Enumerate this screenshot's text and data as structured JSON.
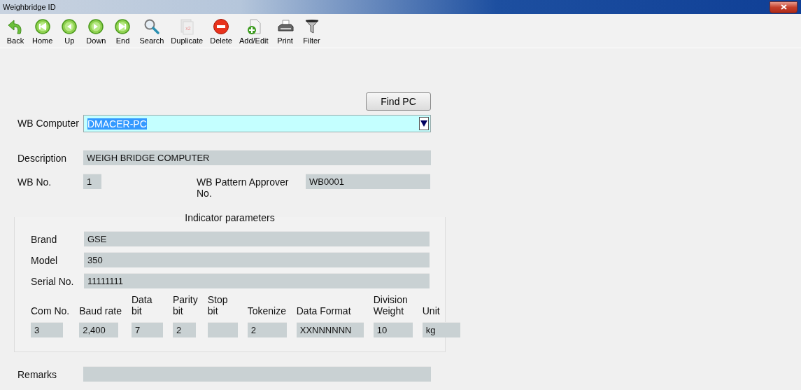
{
  "window": {
    "title": "Weighbridge ID"
  },
  "toolbar": [
    {
      "label": "Back",
      "kind": "back",
      "disabled": false
    },
    {
      "label": "Home",
      "kind": "home",
      "disabled": false
    },
    {
      "label": "Up",
      "kind": "up",
      "disabled": false
    },
    {
      "label": "Down",
      "kind": "down",
      "disabled": false
    },
    {
      "label": "End",
      "kind": "end",
      "disabled": false
    },
    {
      "label": "Search",
      "kind": "search",
      "disabled": false
    },
    {
      "label": "Duplicate",
      "kind": "duplicate",
      "disabled": true,
      "badge": "x2"
    },
    {
      "label": "Delete",
      "kind": "delete",
      "disabled": false
    },
    {
      "label": "Add/Edit",
      "kind": "add",
      "disabled": false
    },
    {
      "label": "Print",
      "kind": "print",
      "disabled": false
    },
    {
      "label": "Filter",
      "kind": "filter",
      "disabled": false
    }
  ],
  "find_button": "Find PC",
  "wb_computer": {
    "label": "WB Computer",
    "value": "DMACER-PC",
    "selected": true
  },
  "description": {
    "label": "Description",
    "value": "WEIGH BRIDGE COMPUTER"
  },
  "wb_no": {
    "label": "WB No.",
    "value": "1"
  },
  "pattern_approver": {
    "label": "WB Pattern Approver No.",
    "value": "WB0001"
  },
  "indicator": {
    "title": "Indicator parameters",
    "rows": [
      {
        "label": "Brand",
        "value": "GSE"
      },
      {
        "label": "Model",
        "value": "350"
      },
      {
        "label": "Serial No.",
        "value": "11111111"
      }
    ],
    "params": [
      {
        "label": "Com No.",
        "value": "3"
      },
      {
        "label": "Baud rate",
        "value": "2,400"
      },
      {
        "label": "Data\nbit",
        "value": "7"
      },
      {
        "label": "Parity\nbit",
        "value": "2"
      },
      {
        "label": "Stop\nbit"
      },
      {
        "label": "Tokenize",
        "value": "2"
      },
      {
        "label": "Data Format",
        "value": "XXNNNNNN"
      },
      {
        "label": "Division\nWeight",
        "value": "10"
      },
      {
        "label": "Unit",
        "value": "kg"
      }
    ]
  },
  "remarks": {
    "label": "Remarks"
  }
}
